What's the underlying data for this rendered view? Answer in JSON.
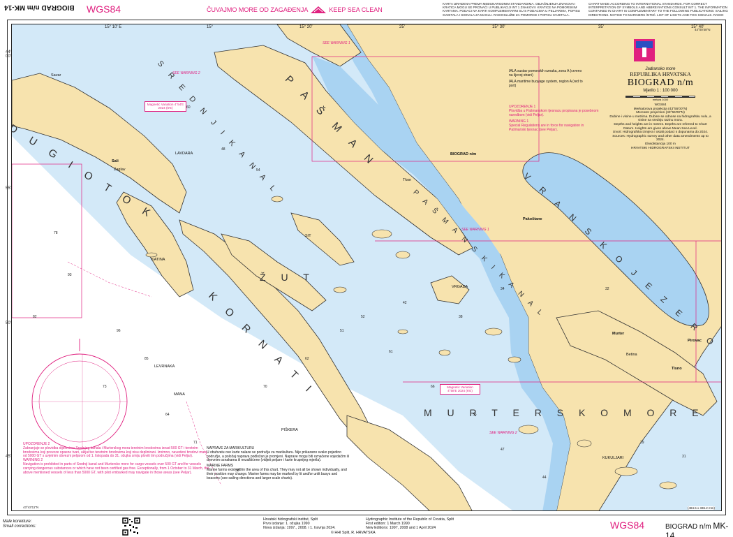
{
  "header": {
    "chart_code_rotated": "BIOGRAD n/m  MK-14",
    "datum": "WGS84",
    "clean_sea_hr": "ČUVAJMO MORE OD ZAGAĐENJA",
    "clean_sea_en": "KEEP SEA CLEAN",
    "notes_hr": "KARTA IZRAĐENA PREMA MEĐUNARODNIM STANDARDIMA. OBJAŠNJENJA ZNAKOVA I KRATICA MOGU SE PRONAĆI U PUBLIKACIJI INT 1 ZNAKOVI I KRATICE NA POMORSKIM KARTAMA. PODACI NA KARTI KOMPLEMENTARNI SU S PODACIMA U PELJARIMA, POPISU SVJETALA I SIGNALA ZA MAGLU, RADIOSLUŽBI ZA POMORCE I POPISU SVJETALA.",
    "notes_en": "CHART MADE ACCORDING TO INTERNATIONAL STANDARDS. FOR CORRECT INTERPRETATION OF SYMBOLS AND ABBREVIATIONS CONSULT INT 1. THE INFORMATION CONTAINED IN CHART IS COMPLEMENTARY TO THE FOLLOWING PUBLICATIONS: SAILING DIRECTIONS, NOTICE TO MARINERS (NTM), LIST OF LIGHTS AND FOG SIGNALS, RADIO SERVICE AND TIDE TABLES."
  },
  "graticule": {
    "top_lon": [
      "15° 10' E",
      "15°",
      "15° 20'",
      "25'",
      "15° 30'",
      "35'",
      "15° 40'"
    ],
    "left_lat": [
      "44° 00'",
      "55'",
      "50'",
      "43° 50'",
      "45'"
    ],
    "corner_ne": "44°00'48\"N",
    "corner_sw": "43°43'11\"N"
  },
  "map_labels": {
    "dugi_otok": "D U G I   O T O K",
    "pasman": "P A Š M A N",
    "kornati": "K O R N A T I",
    "vransko": "V R A N S K O   J E Z E R O",
    "murtersko": "M U R T E R S K O   M O R E",
    "srednji_kanal": "S R E D N J I   K A N A L",
    "pasmanski_kanal": "P A Š M A N S K I   K A N A L",
    "zut": "Ž U T",
    "biograd": "BIOGRAD n/m",
    "pakostane": "Pakoštane",
    "sali": "Sali",
    "savar": "Savar",
    "zaglav": "Zaglav",
    "tkon": "Tkon",
    "pirovac": "Pirovac",
    "tisno": "Tisno",
    "betina": "Betina",
    "murter": "Murter",
    "vrgada": "VRGADA",
    "piskera": "PIŠKERA",
    "mana": "MANA",
    "levrnaka": "LEVRNAKA",
    "lavdara": "LAVDARA",
    "katina": "KATINA",
    "sit": "SIT",
    "kukuljari": "KUKULJARI",
    "see_warning_1": "SEE WARNING 1",
    "see_warning_2": "SEE WARNING 2"
  },
  "magnetic_variation": [
    {
      "text": "Magnetic Variation 4°54'E 2024 (6'E)"
    },
    {
      "text": "Magnetic Variation 4°58'E 2024 (6'E)"
    }
  ],
  "title_block": {
    "sea": "Jadransko more",
    "country": "REPUBLIKA HRVATSKA",
    "title": "BIOGRAD n/m",
    "scale": "Mjerilo 1 : 100 000",
    "scale_bar_label": "metara 1000",
    "info": [
      "WGS84",
      "Merkatorova projekcija (43°55'00\"N)",
      "Mercator projection (43°55'00\"N)",
      "Dubine i visine u metrima. Dubine se odnose na hidrografsku nulu, a visine na srednju razinu mora.",
      "Depths and heights are in metres. Depths are referred to Chart Datum. Heights are given above Mean Sea Level.",
      "Izvori: Hidrografska izmjera i ostali podaci s dopunama do 2024.",
      "Sources: Hydrographic survey and other data amendments up to 2024.",
      "Ekvidistancija 100 m",
      "HRVATSKI HIDROGRAFSKI INSTITUT"
    ]
  },
  "iala": {
    "hr": "IALA sustav pomorskih oznaka, zona A (crveno na lijevoj strani)",
    "en": "IALA maritime buoyage system, region A (red to port)"
  },
  "warning1": {
    "hd_hr": "UPOZORENJE 1",
    "hr": "Plovidba u Pašmanskom tjesnacu propisana je posebnom naredbom (vidi Peljar).",
    "hd_en": "WARNING 1",
    "en": "Special Regulations are in force for navigation in Pašmanski tjesnac (see Peljar)."
  },
  "warning2": {
    "hd_hr": "UPOZORENJE 2",
    "hr": "Zabranjuje se plovidba dijelovima Srednjeg kanala i Murterskog mora teretnim brodovima iznad 500 GT i teretnim brodovima koji prevoze opasne tvari, uključivo teretnim brodovima koji nisu deplinirani. Iznimno, navedeni brodovi manji od 5000 GT s uvjetnim obvezni peljarom od 1. listopada do 31. ožujka smiju ploviti tim područjima (vidi Peljar).",
    "hd_en": "WARNING 2",
    "en": "Navigation is prohibited in parts of Srednji kanal and Murtersko more for cargo vessels over 500 GT and for vessels carrying dangerous substances or which have not been certified gas free. Exceptionally, from 1 October to 31 March, the above mentioned vessels of less than 5000 GT, with pilot embarked may navigate in those areas (see Peljar)."
  },
  "farms": {
    "hd_hr": "NAPRAVE ZA MARIKULTURU",
    "hr": "U obuhvatu ove karte nalaze se područja za marikulturu. Nije prikazano svako pojedino područje, a položaj naprava podložan je promjeni. Naprave mogu biti označene vojedačim ili dnevnim oznakama ili nezaštićene (vidjeti peljare i karte krupnijeg mjerila).",
    "hd_en": "MARINE FARMS",
    "en": "Marine farms exist within the area of this chart. They may not all be shown individually, and their position may change. Marine farms may be marked by lit and/or unlit buoys and beacons (see sailing directions and larger scale charts)."
  },
  "footer": {
    "corrections_hr": "Male korekture:",
    "corrections_en": "Small corrections:",
    "institute_hr": "Hrvatski hidrografski institut, Split",
    "first_hr": "Prvo izdanje: 1. ožujka 1990",
    "new_hr": "Nova izdanja: 1997., 2008. i 1. travnja 2024.",
    "institute_en": "Hydrographic Institute of the Republic of Croatia, Split",
    "first_en": "First edition: 1 March 1990",
    "new_en": "New Editions: 1997, 2008 and 1 April 2024",
    "copyright": "© HHI Split, R. HRVATSKA",
    "datum": "WGS84",
    "title": "BIOGRAD n/m",
    "code": "MK-14",
    "dims": "(484.5 x 336.2 mm)"
  },
  "colors": {
    "land": "#f7e3ae",
    "shallow": "#a9d3f2",
    "mid": "#d3e9f8",
    "deep": "#ffffff",
    "magenta": "#e0207f",
    "coast": "#333333"
  }
}
